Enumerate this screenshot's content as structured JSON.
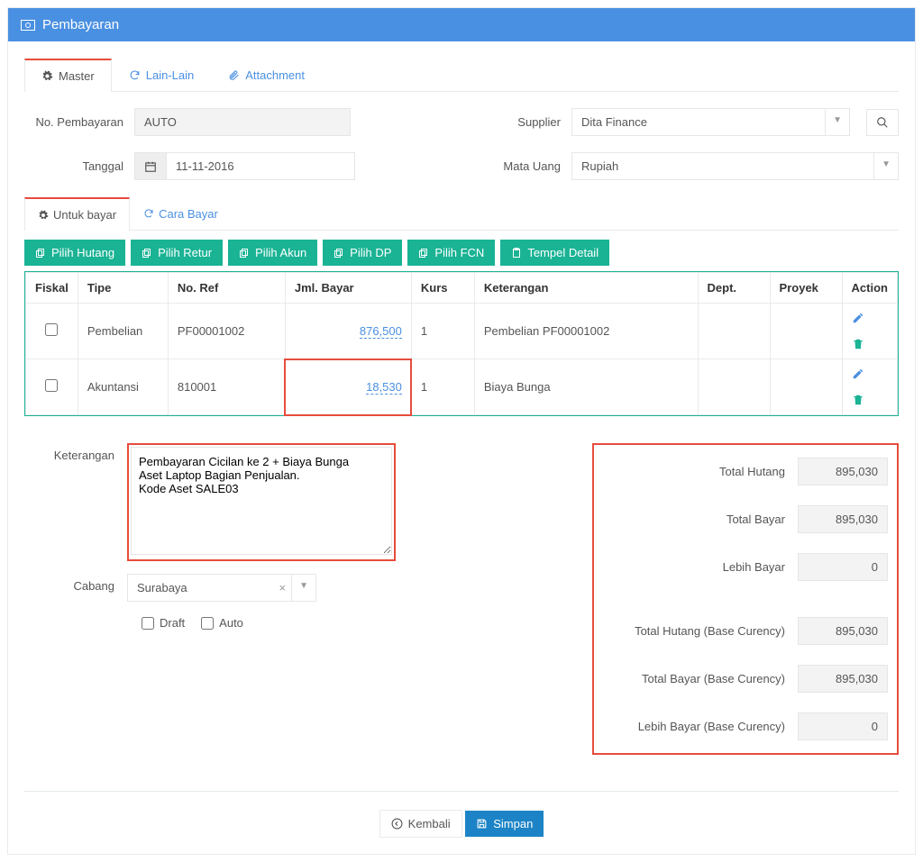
{
  "header": {
    "title": "Pembayaran"
  },
  "tabs": {
    "master": "Master",
    "lain": "Lain-Lain",
    "attachment": "Attachment"
  },
  "form": {
    "no_label": "No. Pembayaran",
    "no_value": "AUTO",
    "tanggal_label": "Tanggal",
    "tanggal_value": "11-11-2016",
    "supplier_label": "Supplier",
    "supplier_value": "Dita Finance",
    "mata_uang_label": "Mata Uang",
    "mata_uang_value": "Rupiah"
  },
  "subtabs": {
    "untuk_bayar": "Untuk bayar",
    "cara_bayar": "Cara Bayar"
  },
  "toolbar": {
    "pilih_hutang": "Pilih Hutang",
    "pilih_retur": "Pilih Retur",
    "pilih_akun": "Pilih Akun",
    "pilih_dp": "Pilih DP",
    "pilih_fcn": "Pilih FCN",
    "tempel_detail": "Tempel Detail"
  },
  "table": {
    "headers": {
      "fiskal": "Fiskal",
      "tipe": "Tipe",
      "noref": "No. Ref",
      "jml": "Jml. Bayar",
      "kurs": "Kurs",
      "ket": "Keterangan",
      "dept": "Dept.",
      "proyek": "Proyek",
      "action": "Action"
    },
    "rows": [
      {
        "tipe": "Pembelian",
        "noref": "PF00001002",
        "jml": "876,500",
        "kurs": "1",
        "ket": "Pembelian PF00001002",
        "highlight": false
      },
      {
        "tipe": "Akuntansi",
        "noref": "810001",
        "jml": "18,530",
        "kurs": "1",
        "ket": "Biaya Bunga",
        "highlight": true
      }
    ]
  },
  "ket_label": "Keterangan",
  "ket_value": "Pembayaran Cicilan ke 2 + Biaya Bunga\nAset Laptop Bagian Penjualan.\nKode Aset SALE03",
  "cabang_label": "Cabang",
  "cabang_value": "Surabaya",
  "flags": {
    "draft": "Draft",
    "auto": "Auto"
  },
  "totals": {
    "total_hutang_label": "Total Hutang",
    "total_hutang": "895,030",
    "total_bayar_label": "Total Bayar",
    "total_bayar": "895,030",
    "lebih_bayar_label": "Lebih Bayar",
    "lebih_bayar": "0",
    "total_hutang_base_label": "Total Hutang (Base Curency)",
    "total_hutang_base": "895,030",
    "total_bayar_base_label": "Total Bayar (Base Curency)",
    "total_bayar_base": "895,030",
    "lebih_bayar_base_label": "Lebih Bayar (Base Curency)",
    "lebih_bayar_base": "0"
  },
  "footer": {
    "kembali": "Kembali",
    "simpan": "Simpan"
  }
}
